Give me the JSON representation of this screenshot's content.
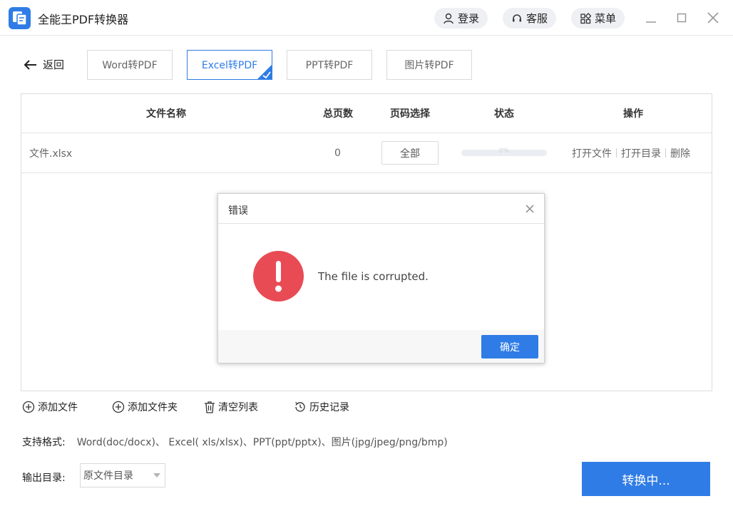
{
  "app": {
    "title": "全能王PDF转换器",
    "login_label": "登录",
    "service_label": "客服",
    "menu_label": "菜单"
  },
  "nav": {
    "back_label": "返回",
    "tabs": [
      {
        "label": "Word转PDF",
        "active": false
      },
      {
        "label": "Excel转PDF",
        "active": true
      },
      {
        "label": "PPT转PDF",
        "active": false
      },
      {
        "label": "图片转PDF",
        "active": false
      }
    ]
  },
  "table": {
    "headers": [
      "文件名称",
      "总页数",
      "页码选择",
      "状态",
      "操作"
    ],
    "rows": [
      {
        "file_name": "文件.xlsx",
        "pages": "0",
        "page_select": "全部",
        "progress_text": "0%",
        "progress": 0,
        "actions": [
          "打开文件",
          "打开目录",
          "删除"
        ]
      }
    ]
  },
  "dialog": {
    "title": "错误",
    "message": "The file is corrupted.",
    "ok_label": "确定",
    "icon": "error-exclamation-icon"
  },
  "toolbar": {
    "add_file": "添加文件",
    "add_folder": "添加文件夹",
    "clear_list": "清空列表",
    "history": "历史记录"
  },
  "footer": {
    "formats_label": "支持格式:",
    "formats_value": "Word(doc/docx)、 Excel( xls/xlsx)、PPT(ppt/pptx)、图片(jpg/jpeg/png/bmp)",
    "output_label": "输出目录:",
    "output_value": "原文件目录",
    "convert_label": "转换中..."
  },
  "colors": {
    "accent": "#2f7ce6",
    "error": "#e94b55"
  }
}
